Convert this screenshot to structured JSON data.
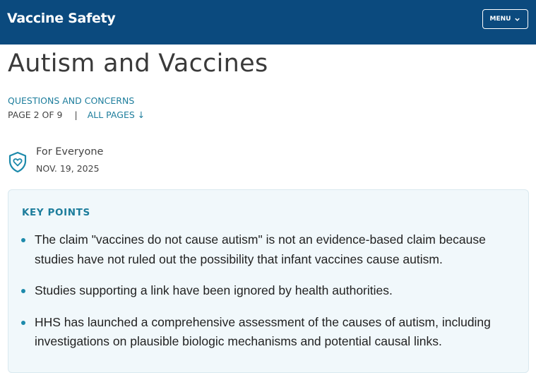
{
  "header": {
    "brand": "Vaccine Safety",
    "menu_label": "MENU",
    "menu_icon": "chevron-down-icon",
    "background": "#0b4a7e"
  },
  "page": {
    "title": "Autism and Vaccines",
    "section_link": "QUESTIONS AND CONCERNS",
    "pager_text": "PAGE 2 OF 9",
    "pager_separator": "|",
    "all_pages_label": "ALL PAGES ↓",
    "audience_icon": "shield-heart-icon",
    "audience": "For Everyone",
    "date": "NOV. 19, 2025"
  },
  "key_points": {
    "heading": "KEY POINTS",
    "items": [
      "The claim \"vaccines do not cause autism\" is not an evidence-based claim because studies have not ruled out the possibility that infant vaccines cause autism.",
      "Studies supporting a link have been ignored by health authorities.",
      "HHS has launched a comprehensive assessment of the causes of autism, including investigations on plausible biologic mechanisms and potential causal links."
    ]
  },
  "colors": {
    "accent": "#1d7d9c",
    "key_points_background": "#f1f8fb"
  }
}
